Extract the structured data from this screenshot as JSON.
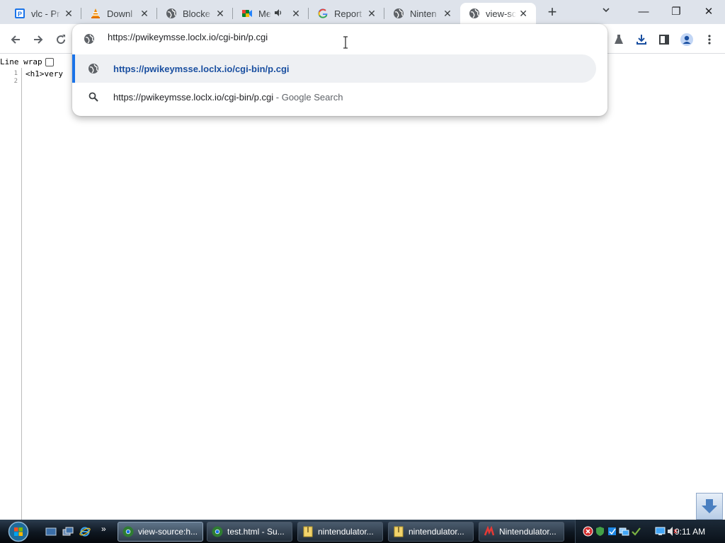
{
  "tabs": [
    {
      "title": "vlc - Pr",
      "icon": "p-doc-icon"
    },
    {
      "title": "Downl",
      "icon": "vlc-cone-icon"
    },
    {
      "title": "Blocke",
      "icon": "globe-icon"
    },
    {
      "title": "Me",
      "icon": "meet-icon",
      "audio": true
    },
    {
      "title": "Report",
      "icon": "google-g-icon"
    },
    {
      "title": "Ninten",
      "icon": "globe-icon"
    },
    {
      "title": "view-sc",
      "icon": "globe-icon",
      "active": true
    }
  ],
  "tab_close_glyph": "✕",
  "new_tab_glyph": "+",
  "window_controls": {
    "minimize": "—",
    "restore": "❐",
    "close": "✕"
  },
  "omnibox": {
    "input_value": "https://pwikeymsse.loclx.io/cgi-bin/p.cgi",
    "suggestions": [
      {
        "text": "https://pwikeymsse.loclx.io/cgi-bin/p.cgi",
        "icon": "globe-icon",
        "selected": true
      },
      {
        "text": "https://pwikeymsse.loclx.io/cgi-bin/p.cgi",
        "desc": " - Google Search",
        "icon": "search-icon"
      }
    ]
  },
  "view_source": {
    "line_wrap_label": "Line wrap",
    "line_wrap_checked": false,
    "line_numbers": [
      "1",
      "2"
    ],
    "line1": "<h1>very"
  },
  "taskbar": {
    "buttons": [
      {
        "label": "view-source:h...",
        "active": true
      },
      {
        "label": "test.html - Su..."
      },
      {
        "label": "nintendulator..."
      },
      {
        "label": "nintendulator..."
      },
      {
        "label": "Nintendulator..."
      }
    ],
    "quicklaunch_more": "»",
    "clock": "9:11 AM"
  },
  "colors": {
    "accent": "#1a73e8",
    "tabstrip": "#dee3eb",
    "taskbar": "#0e1620"
  }
}
